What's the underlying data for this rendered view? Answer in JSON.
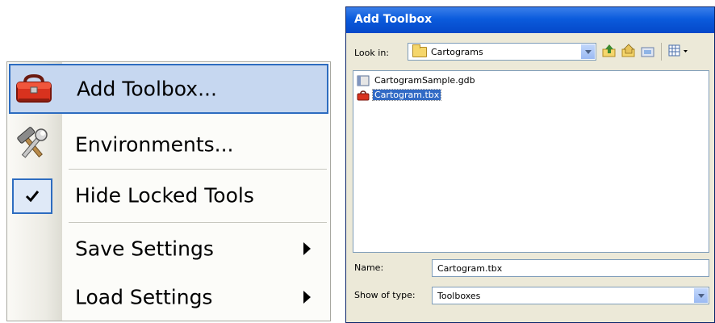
{
  "context_menu": {
    "items": [
      {
        "label": "Add Toolbox...",
        "icon": "toolbox-icon",
        "highlighted": true
      },
      {
        "label": "Environments...",
        "icon": "hammer-wrench-icon"
      },
      {
        "label": "Hide Locked Tools",
        "icon": "checkmark-icon",
        "checked": true
      },
      {
        "label": "Save Settings",
        "has_submenu": true
      },
      {
        "label": "Load Settings",
        "has_submenu": true
      }
    ],
    "colors": {
      "highlight_bg": "#c6d7f0",
      "highlight_border": "#2d6cc0"
    }
  },
  "dialog": {
    "title": "Add Toolbox",
    "look_in_label": "Look in:",
    "look_in_value": "Cartograms",
    "toolbar": [
      "up-one-level-icon",
      "home-folder-icon",
      "connect-folder-icon",
      "view-menu-icon"
    ],
    "files": [
      {
        "name": "CartogramSample.gdb",
        "icon": "geodatabase-icon",
        "selected": false
      },
      {
        "name": "Cartogram.tbx",
        "icon": "toolbox-file-icon",
        "selected": true
      }
    ],
    "name_label": "Name:",
    "name_value": "Cartogram.tbx",
    "type_label": "Show of type:",
    "type_value": "Toolboxes",
    "colors": {
      "titlebar": "#0b5bdc",
      "selection": "#316ac5",
      "face": "#ece9d8"
    }
  }
}
